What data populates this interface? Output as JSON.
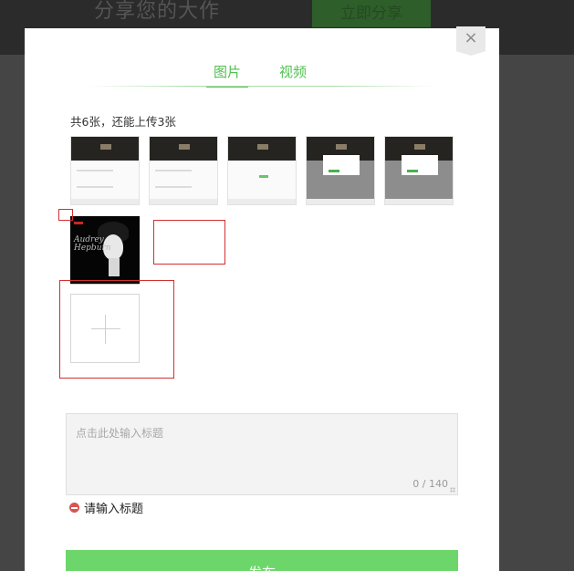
{
  "background": {
    "title": "分享您的大作",
    "subtitle": "",
    "share_button": "立即分享"
  },
  "modal": {
    "close_symbol": "×",
    "tabs": [
      {
        "label": "图片",
        "active": true
      },
      {
        "label": "视频",
        "active": false
      }
    ],
    "count_text": "共6张，还能上传3张",
    "title_field": {
      "placeholder": "点击此处输入标题",
      "value": "",
      "char_count": "0 / 140"
    },
    "error_text": "请输入标题",
    "publish_label": "发布"
  },
  "colors": {
    "accent_green": "#5cc859",
    "button_green": "#6cd66a",
    "error_red": "#d9534f"
  }
}
